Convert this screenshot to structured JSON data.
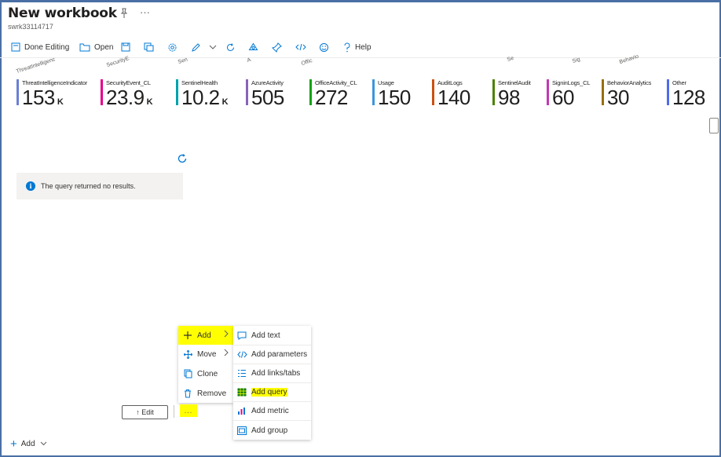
{
  "header": {
    "title": "New workbook",
    "subtitle": "swrk33114717",
    "more": "···"
  },
  "toolbar": {
    "done_editing": "Done Editing",
    "open": "Open",
    "help": "Help"
  },
  "tile_headers_rotated": [
    "ThreatIntelligenc",
    "SecurityE",
    "Sen",
    "A",
    "Offic",
    "Se",
    "Sig",
    "Behavio"
  ],
  "tiles": [
    {
      "name": "ThreatIntelligenceIndicator",
      "value": "153",
      "unit": "K",
      "color": "#6b7fd6"
    },
    {
      "name": "SecurityEvent_CL",
      "value": "23.9",
      "unit": "K",
      "color": "#e3008c"
    },
    {
      "name": "SentinelHealth",
      "value": "10.2",
      "unit": "K",
      "color": "#00a2ad"
    },
    {
      "name": "AzureActivity",
      "value": "505",
      "unit": "",
      "color": "#8764b8"
    },
    {
      "name": "OfficeActivity_CL",
      "value": "272",
      "unit": "",
      "color": "#13a10e"
    },
    {
      "name": "Usage",
      "value": "150",
      "unit": "",
      "color": "#3a96dd"
    },
    {
      "name": "AuditLogs",
      "value": "140",
      "unit": "",
      "color": "#ca5010"
    },
    {
      "name": "SentinelAudit",
      "value": "98",
      "unit": "",
      "color": "#498205"
    },
    {
      "name": "SigninLogs_CL",
      "value": "60",
      "unit": "",
      "color": "#c239b3"
    },
    {
      "name": "BehaviorAnalytics",
      "value": "30",
      "unit": "",
      "color": "#986f0b"
    },
    {
      "name": "Other",
      "value": "128",
      "unit": "",
      "color": "#4f6bed"
    }
  ],
  "message": {
    "no_results": "The query returned no results."
  },
  "context_menu": {
    "add": "Add",
    "move": "Move",
    "clone": "Clone",
    "remove": "Remove"
  },
  "add_submenu": {
    "add_text": "Add text",
    "add_parameters": "Add parameters",
    "add_links_tabs": "Add links/tabs",
    "add_query": "Add query",
    "add_metric": "Add metric",
    "add_group": "Add group"
  },
  "bottom": {
    "edit": "↑ Edit",
    "ellipsis": "...",
    "add": "Add"
  },
  "colors": {
    "accent": "#0078d4",
    "highlight": "#ffff00"
  }
}
